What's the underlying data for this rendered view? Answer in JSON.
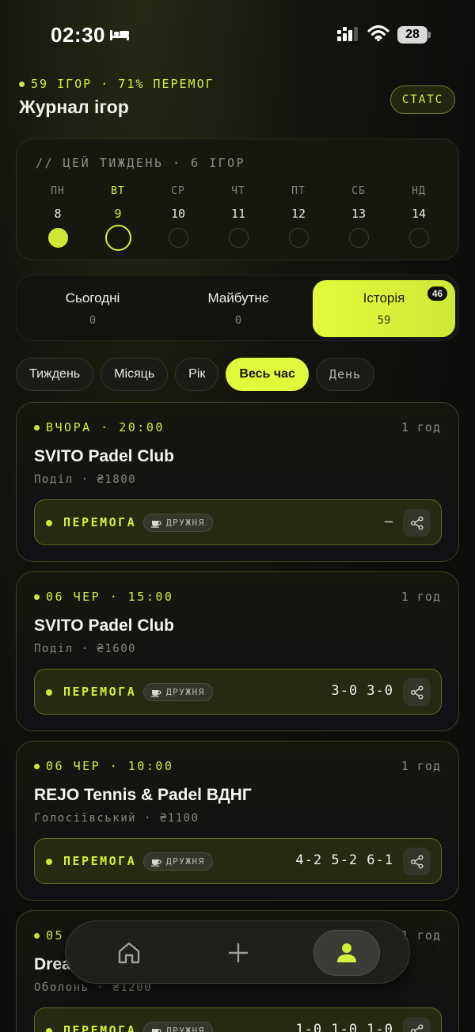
{
  "status_bar": {
    "time": "02:30",
    "battery": "28"
  },
  "header": {
    "summary": "59 ІГОР · 71% ПЕРЕМОГ",
    "title": "Журнал ігор",
    "stats_button": "СТАТС"
  },
  "week": {
    "title": "// ЦЕЙ ТИЖДЕНЬ · 6 ІГОР",
    "days": [
      {
        "name": "ПН",
        "num": "8"
      },
      {
        "name": "ВТ",
        "num": "9"
      },
      {
        "name": "СР",
        "num": "10"
      },
      {
        "name": "ЧТ",
        "num": "11"
      },
      {
        "name": "ПТ",
        "num": "12"
      },
      {
        "name": "СБ",
        "num": "13"
      },
      {
        "name": "НД",
        "num": "14"
      }
    ]
  },
  "segments": [
    {
      "label": "Сьогодні",
      "count": "0"
    },
    {
      "label": "Майбутнє",
      "count": "0"
    },
    {
      "label": "Історія",
      "count": "59",
      "badge": "46"
    }
  ],
  "filters": [
    "Тиждень",
    "Місяць",
    "Рік",
    "Весь час",
    "День"
  ],
  "games": [
    {
      "date": "ВЧОРА · 20:00",
      "duration": "1 год",
      "venue": "SVITO Padel Club",
      "sub": "Поділ · ₴1800",
      "result": "ПЕРЕМОГА",
      "tag": "ДРУЖНЯ",
      "score": "–"
    },
    {
      "date": "06 ЧЕР · 15:00",
      "duration": "1 год",
      "venue": "SVITO Padel Club",
      "sub": "Поділ · ₴1600",
      "result": "ПЕРЕМОГА",
      "tag": "ДРУЖНЯ",
      "score": "3-0 3-0"
    },
    {
      "date": "06 ЧЕР · 10:00",
      "duration": "1 год",
      "venue": "REJO Tennis & Padel ВДНГ",
      "sub": "Голосіївський · ₴1100",
      "result": "ПЕРЕМОГА",
      "tag": "ДРУЖНЯ",
      "score": "4-2 5-2 6-1"
    },
    {
      "date": "05",
      "duration": "1 год",
      "venue": "Drea",
      "sub": "Оболонь · ₴1200",
      "result": "ПЕРЕМОГА",
      "tag": "ДРУЖНЯ",
      "score": "1-0 1-0 1-0"
    }
  ],
  "nav": [
    "home-icon",
    "plus-icon",
    "profile-icon"
  ],
  "colors": {
    "accent": "#d4f03a",
    "background": "#0e0f0d"
  }
}
